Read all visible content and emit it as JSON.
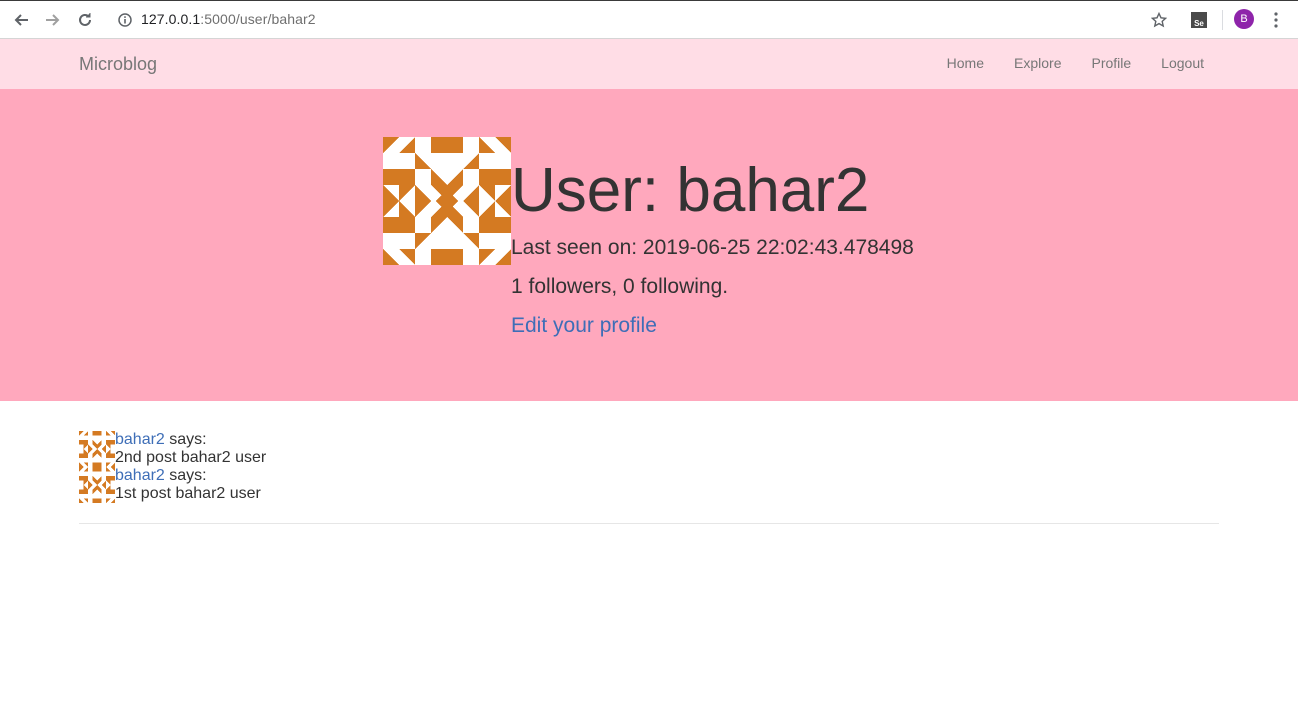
{
  "browser": {
    "url_host": "127.0.0.1",
    "url_rest": ":5000/user/bahar2",
    "profile_initial": "B",
    "extension_label": "Se"
  },
  "navbar": {
    "brand": "Microblog",
    "links": [
      "Home",
      "Explore",
      "Profile",
      "Logout"
    ]
  },
  "profile": {
    "title": "User: bahar2",
    "last_seen": "Last seen on: 2019-06-25 22:02:43.478498",
    "followers": "1 followers, 0 following.",
    "edit_link": "Edit your profile"
  },
  "posts": [
    {
      "author": "bahar2",
      "says": " says:",
      "body": "2nd post bahar2 user"
    },
    {
      "author": "bahar2",
      "says": " says:",
      "body": "1st post bahar2 user"
    }
  ],
  "colors": {
    "navbar_bg": "#ffdde6",
    "jumbo_bg": "#ffa8bd",
    "link": "#3e6eb7",
    "identicon": "#d47a22"
  }
}
